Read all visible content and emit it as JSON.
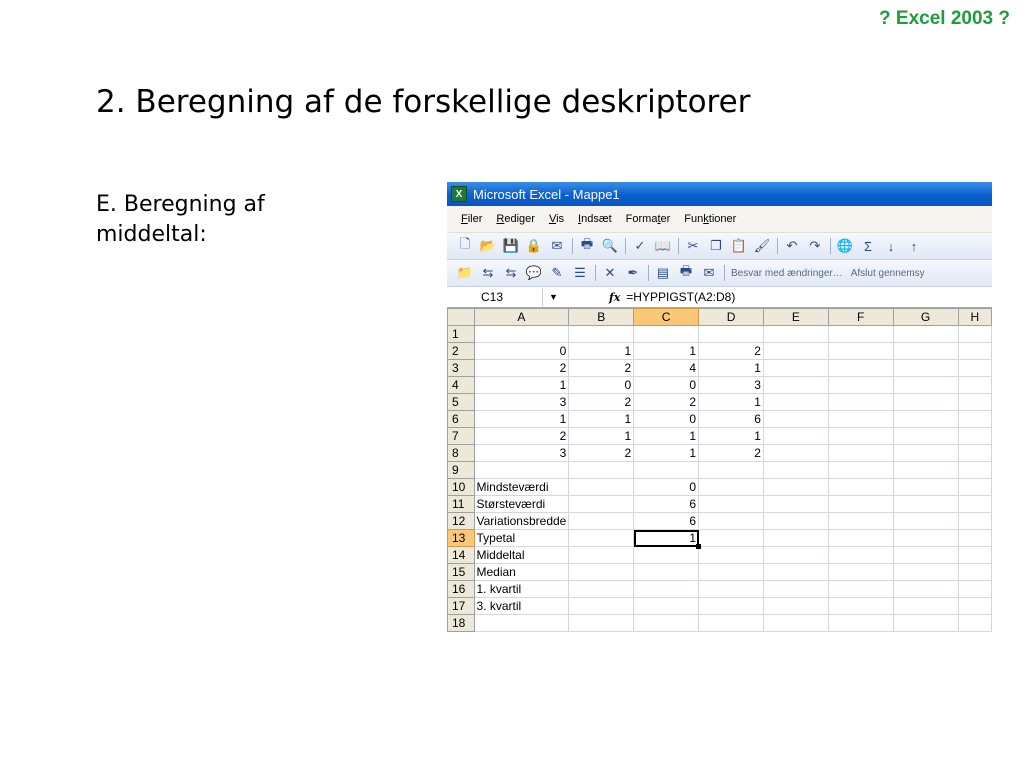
{
  "slide": {
    "corner_tag": "? Excel 2003 ?",
    "title": "2. Beregning af de forskellige deskriptorer",
    "body": "E. Beregning af middeltal:"
  },
  "excel": {
    "window_title": "Microsoft Excel - Mappe1",
    "menu": [
      "Filer",
      "Rediger",
      "Vis",
      "Indsæt",
      "Formater",
      "Funktioner"
    ],
    "review_bar": {
      "reply_label": "Besvar med ændringer…",
      "end_label": "Afslut gennemsy"
    },
    "name_box": "C13",
    "formula": "=HYPPIGST(A2:D8)",
    "columns": [
      "A",
      "B",
      "C",
      "D",
      "E",
      "F",
      "G",
      "H"
    ],
    "selected_column": "C",
    "selected_row": "13",
    "rows": [
      {
        "n": "1",
        "cells": [
          "",
          "",
          "",
          ""
        ]
      },
      {
        "n": "2",
        "cells": [
          "0",
          "1",
          "1",
          "2"
        ]
      },
      {
        "n": "3",
        "cells": [
          "2",
          "2",
          "4",
          "1"
        ]
      },
      {
        "n": "4",
        "cells": [
          "1",
          "0",
          "0",
          "3"
        ]
      },
      {
        "n": "5",
        "cells": [
          "3",
          "2",
          "2",
          "1"
        ]
      },
      {
        "n": "6",
        "cells": [
          "1",
          "1",
          "0",
          "6"
        ]
      },
      {
        "n": "7",
        "cells": [
          "2",
          "1",
          "1",
          "1"
        ]
      },
      {
        "n": "8",
        "cells": [
          "3",
          "2",
          "1",
          "2"
        ]
      },
      {
        "n": "9",
        "cells": [
          "",
          "",
          "",
          ""
        ]
      },
      {
        "n": "10",
        "label": "Mindsteværdi",
        "c": "0"
      },
      {
        "n": "11",
        "label": "Størsteværdi",
        "c": "6"
      },
      {
        "n": "12",
        "label": "Variationsbredde",
        "c": "6"
      },
      {
        "n": "13",
        "label": "Typetal",
        "c": "1"
      },
      {
        "n": "14",
        "label": "Middeltal",
        "c": ""
      },
      {
        "n": "15",
        "label": "Median",
        "c": ""
      },
      {
        "n": "16",
        "label": "1. kvartil",
        "c": ""
      },
      {
        "n": "17",
        "label": "3. kvartil",
        "c": ""
      },
      {
        "n": "18",
        "label": "",
        "c": ""
      }
    ]
  }
}
